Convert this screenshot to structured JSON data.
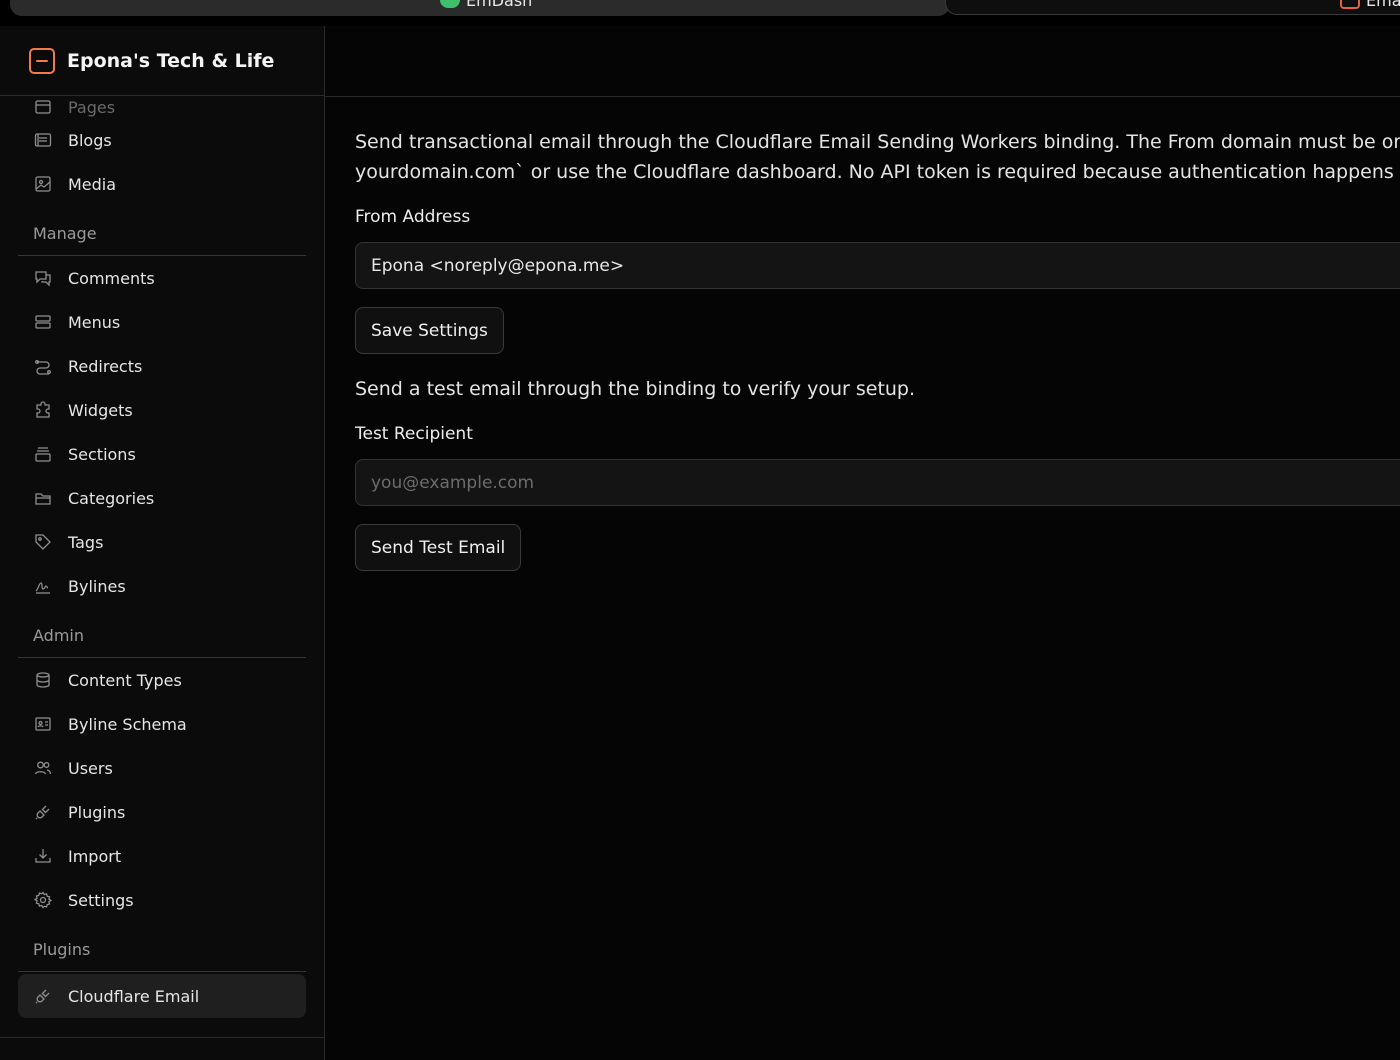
{
  "browser": {
    "tab_left_label": "EmDash",
    "tab_right_label": "Email"
  },
  "brand": {
    "title": "Epona's Tech & Life"
  },
  "sidebar": {
    "content_items": [
      {
        "label": "Pages",
        "icon": "pages-icon"
      },
      {
        "label": "Blogs",
        "icon": "blogs-icon"
      },
      {
        "label": "Media",
        "icon": "media-icon"
      }
    ],
    "manage_label": "Manage",
    "manage_items": [
      {
        "label": "Comments",
        "icon": "comments-icon"
      },
      {
        "label": "Menus",
        "icon": "menus-icon"
      },
      {
        "label": "Redirects",
        "icon": "redirects-icon"
      },
      {
        "label": "Widgets",
        "icon": "widgets-icon"
      },
      {
        "label": "Sections",
        "icon": "sections-icon"
      },
      {
        "label": "Categories",
        "icon": "categories-icon"
      },
      {
        "label": "Tags",
        "icon": "tags-icon"
      },
      {
        "label": "Bylines",
        "icon": "bylines-icon"
      }
    ],
    "admin_label": "Admin",
    "admin_items": [
      {
        "label": "Content Types",
        "icon": "database-icon"
      },
      {
        "label": "Byline Schema",
        "icon": "id-card-icon"
      },
      {
        "label": "Users",
        "icon": "users-icon"
      },
      {
        "label": "Plugins",
        "icon": "plug-icon"
      },
      {
        "label": "Import",
        "icon": "import-icon"
      },
      {
        "label": "Settings",
        "icon": "gear-icon"
      }
    ],
    "plugins_label": "Plugins",
    "plugin_items": [
      {
        "label": "Cloudflare Email",
        "icon": "plug-icon",
        "active": true
      }
    ]
  },
  "main": {
    "description_line1": "Send transactional email through the Cloudflare Email Sending Workers binding. The From domain must be onb",
    "description_line2": "yourdomain.com` or use the Cloudflare dashboard. No API token is required because authentication happens vi",
    "from_label": "From Address",
    "from_value": "Epona <noreply@epona.me>",
    "save_label": "Save Settings",
    "test_description": "Send a test email through the binding to verify your setup.",
    "recipient_label": "Test Recipient",
    "recipient_placeholder": "you@example.com",
    "send_label": "Send Test Email"
  },
  "colors": {
    "accent": "#f07c4c",
    "background": "#050505",
    "sidebar": "#0b0b0b",
    "active_item": "#1f1f1f"
  }
}
